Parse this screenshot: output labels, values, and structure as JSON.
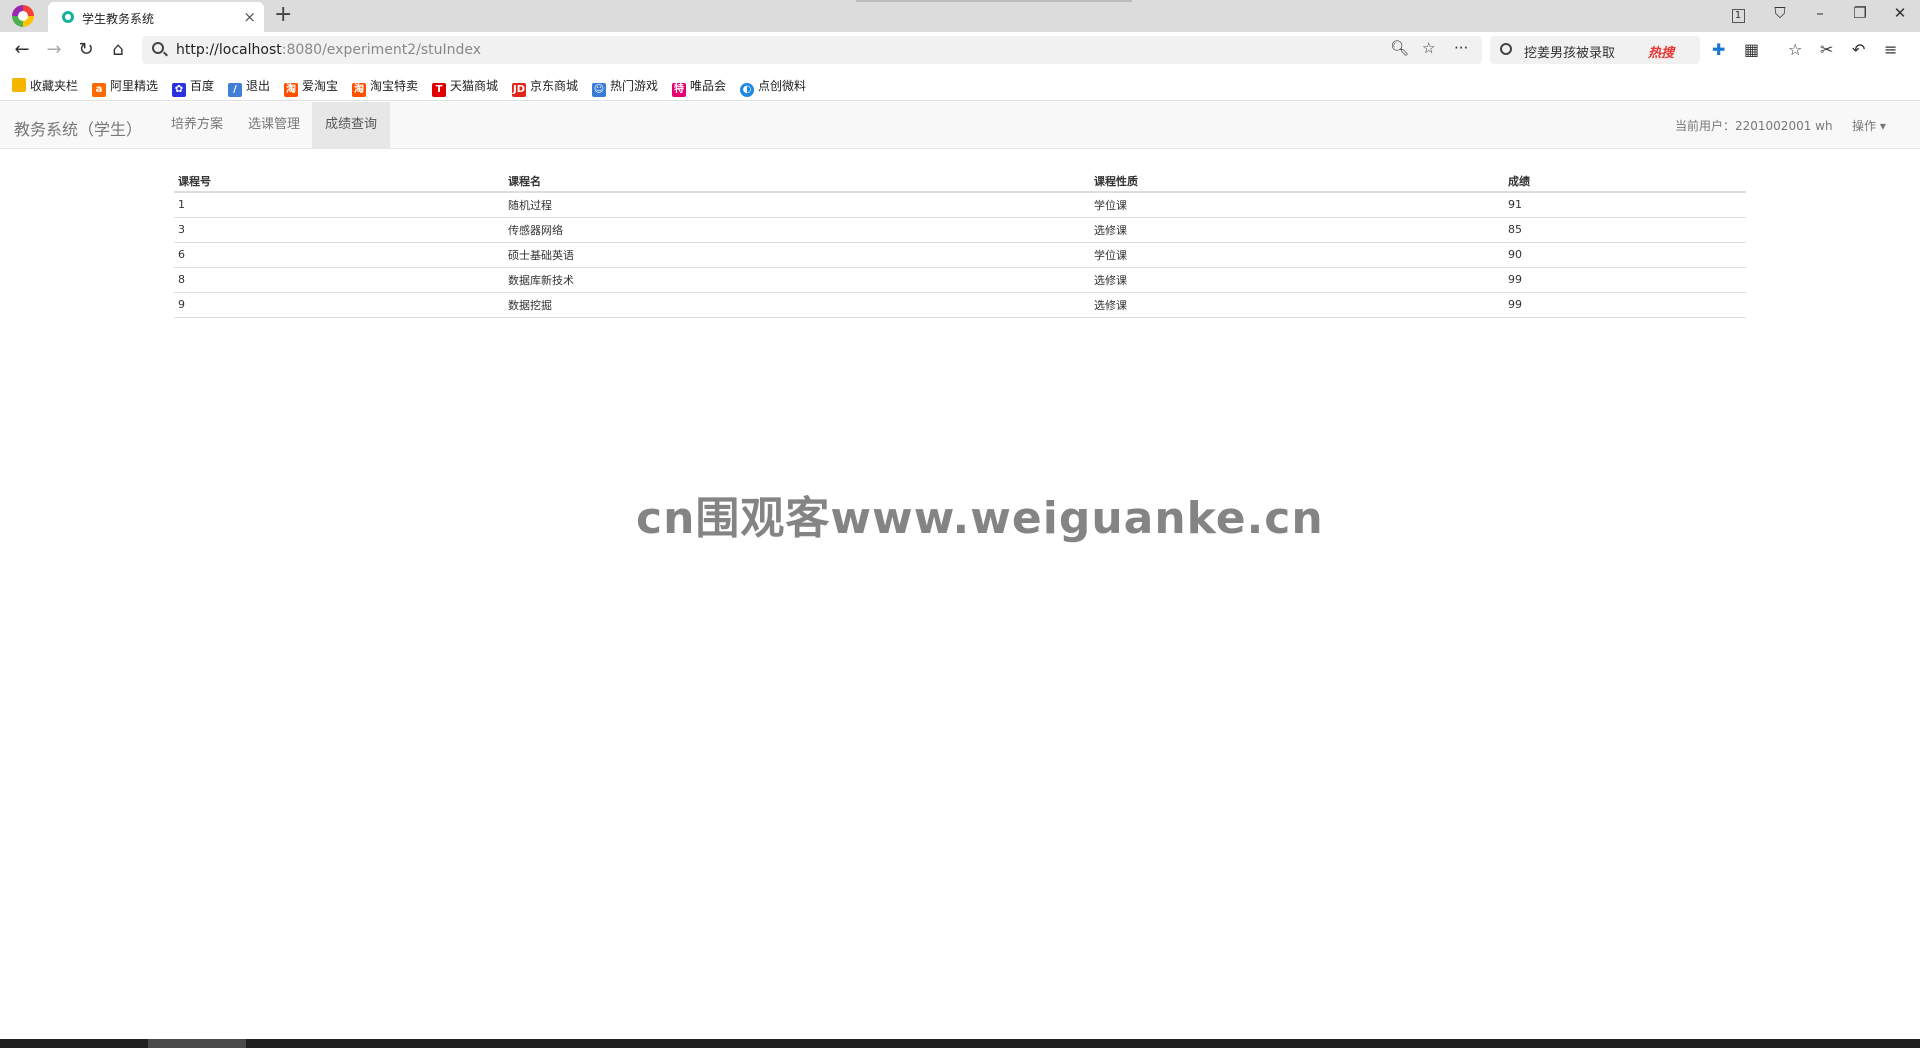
{
  "browser": {
    "tab_title": "学生教务系统",
    "tab_count": "1",
    "url_host": "http://localhost",
    "url_path": ":8080/experiment2/stuIndex",
    "search_text": "挖姜男孩被录取",
    "search_hot": "热搜",
    "bookmarks": [
      "收藏夹栏",
      "阿里精选",
      "百度",
      "退出",
      "爱淘宝",
      "淘宝特卖",
      "天猫商城",
      "京东商城",
      "热门游戏",
      "唯品会",
      "点创微料"
    ]
  },
  "app": {
    "brand": "教务系统（学生）",
    "nav": [
      "培养方案",
      "选课管理",
      "成绩查询"
    ],
    "current_user": "当前用户：2201002001 wh",
    "operation": "操作 ▾"
  },
  "table": {
    "headers": [
      "课程号",
      "课程名",
      "课程性质",
      "成绩"
    ],
    "rows": [
      [
        "1",
        "随机过程",
        "学位课",
        "91"
      ],
      [
        "3",
        "传感器网络",
        "选修课",
        "85"
      ],
      [
        "6",
        "硕士基础英语",
        "学位课",
        "90"
      ],
      [
        "8",
        "数据库新技术",
        "选修课",
        "99"
      ],
      [
        "9",
        "数据挖掘",
        "选修课",
        "99"
      ]
    ]
  },
  "watermark": "cn围观客www.weiguanke.cn",
  "colors": {
    "active_nav_bg": "#e7e7e7",
    "nav_bg": "#f8f8f8",
    "hot_red": "#e53935"
  }
}
